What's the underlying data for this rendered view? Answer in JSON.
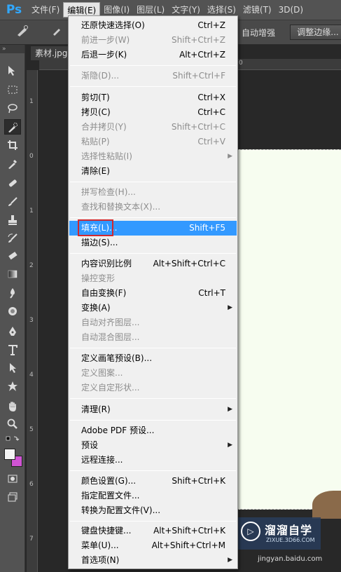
{
  "app": {
    "logo": "Ps"
  },
  "menubar": {
    "items": [
      {
        "label": "文件(F)"
      },
      {
        "label": "编辑(E)",
        "active": true
      },
      {
        "label": "图像(I)"
      },
      {
        "label": "图层(L)"
      },
      {
        "label": "文字(Y)"
      },
      {
        "label": "选择(S)"
      },
      {
        "label": "滤镜(T)"
      },
      {
        "label": "3D(D)"
      }
    ]
  },
  "options": {
    "auto_enhance": "自动增强",
    "refine_edge": "调整边缘..."
  },
  "toolbox": {
    "collapse_glyph": "»"
  },
  "document": {
    "tab": "素材.jpg"
  },
  "ruler": {
    "top_labels": [
      "0"
    ],
    "left_labels": [
      "1",
      "0",
      "1",
      "2",
      "3",
      "4",
      "5",
      "6",
      "7"
    ]
  },
  "watermark": {
    "logo": "▷",
    "title": "溜溜自学",
    "subtitle": "ZIXUE.3D66.COM",
    "site": "jingyan.baidu.com"
  },
  "edit_menu": {
    "highlighted_index": 13,
    "items": [
      {
        "label": "还原快速选择(O)",
        "shortcut": "Ctrl+Z",
        "enabled": true
      },
      {
        "label": "前进一步(W)",
        "shortcut": "Shift+Ctrl+Z",
        "enabled": false
      },
      {
        "label": "后退一步(K)",
        "shortcut": "Alt+Ctrl+Z",
        "enabled": true
      },
      {
        "label": "渐隐(D)...",
        "shortcut": "Shift+Ctrl+F",
        "enabled": false
      },
      {
        "label": "剪切(T)",
        "shortcut": "Ctrl+X",
        "enabled": true
      },
      {
        "label": "拷贝(C)",
        "shortcut": "Ctrl+C",
        "enabled": true
      },
      {
        "label": "合并拷贝(Y)",
        "shortcut": "Shift+Ctrl+C",
        "enabled": false
      },
      {
        "label": "粘贴(P)",
        "shortcut": "Ctrl+V",
        "enabled": false
      },
      {
        "label": "选择性粘贴(I)",
        "shortcut": "",
        "enabled": false,
        "submenu": true
      },
      {
        "label": "清除(E)",
        "shortcut": "",
        "enabled": true
      },
      {
        "label": "拼写检查(H)...",
        "shortcut": "",
        "enabled": false
      },
      {
        "label": "查找和替换文本(X)...",
        "shortcut": "",
        "enabled": false
      },
      {
        "label": "填充(L)...",
        "shortcut": "Shift+F5",
        "enabled": true
      },
      {
        "label": "描边(S)...",
        "shortcut": "",
        "enabled": true
      },
      {
        "label": "内容识别比例",
        "shortcut": "Alt+Shift+Ctrl+C",
        "enabled": true
      },
      {
        "label": "操控变形",
        "shortcut": "",
        "enabled": false
      },
      {
        "label": "自由变换(F)",
        "shortcut": "Ctrl+T",
        "enabled": true
      },
      {
        "label": "变换(A)",
        "shortcut": "",
        "enabled": true,
        "submenu": true
      },
      {
        "label": "自动对齐图层...",
        "shortcut": "",
        "enabled": false
      },
      {
        "label": "自动混合图层...",
        "shortcut": "",
        "enabled": false
      },
      {
        "label": "定义画笔预设(B)...",
        "shortcut": "",
        "enabled": true
      },
      {
        "label": "定义图案...",
        "shortcut": "",
        "enabled": false
      },
      {
        "label": "定义自定形状...",
        "shortcut": "",
        "enabled": false
      },
      {
        "label": "清理(R)",
        "shortcut": "",
        "enabled": true,
        "submenu": true
      },
      {
        "label": "Adobe PDF 预设...",
        "shortcut": "",
        "enabled": true
      },
      {
        "label": "预设",
        "shortcut": "",
        "enabled": true,
        "submenu": true
      },
      {
        "label": "远程连接...",
        "shortcut": "",
        "enabled": true
      },
      {
        "label": "颜色设置(G)...",
        "shortcut": "Shift+Ctrl+K",
        "enabled": true
      },
      {
        "label": "指定配置文件...",
        "shortcut": "",
        "enabled": true
      },
      {
        "label": "转换为配置文件(V)...",
        "shortcut": "",
        "enabled": true
      },
      {
        "label": "键盘快捷键...",
        "shortcut": "Alt+Shift+Ctrl+K",
        "enabled": true
      },
      {
        "label": "菜单(U)...",
        "shortcut": "Alt+Shift+Ctrl+M",
        "enabled": true
      },
      {
        "label": "首选项(N)",
        "shortcut": "",
        "enabled": true,
        "submenu": true
      }
    ]
  },
  "colors": {
    "highlight": "#3399ff",
    "fill_callout": "#d2282e",
    "foreground": "#f4f4f4",
    "background": "#d054d4"
  }
}
